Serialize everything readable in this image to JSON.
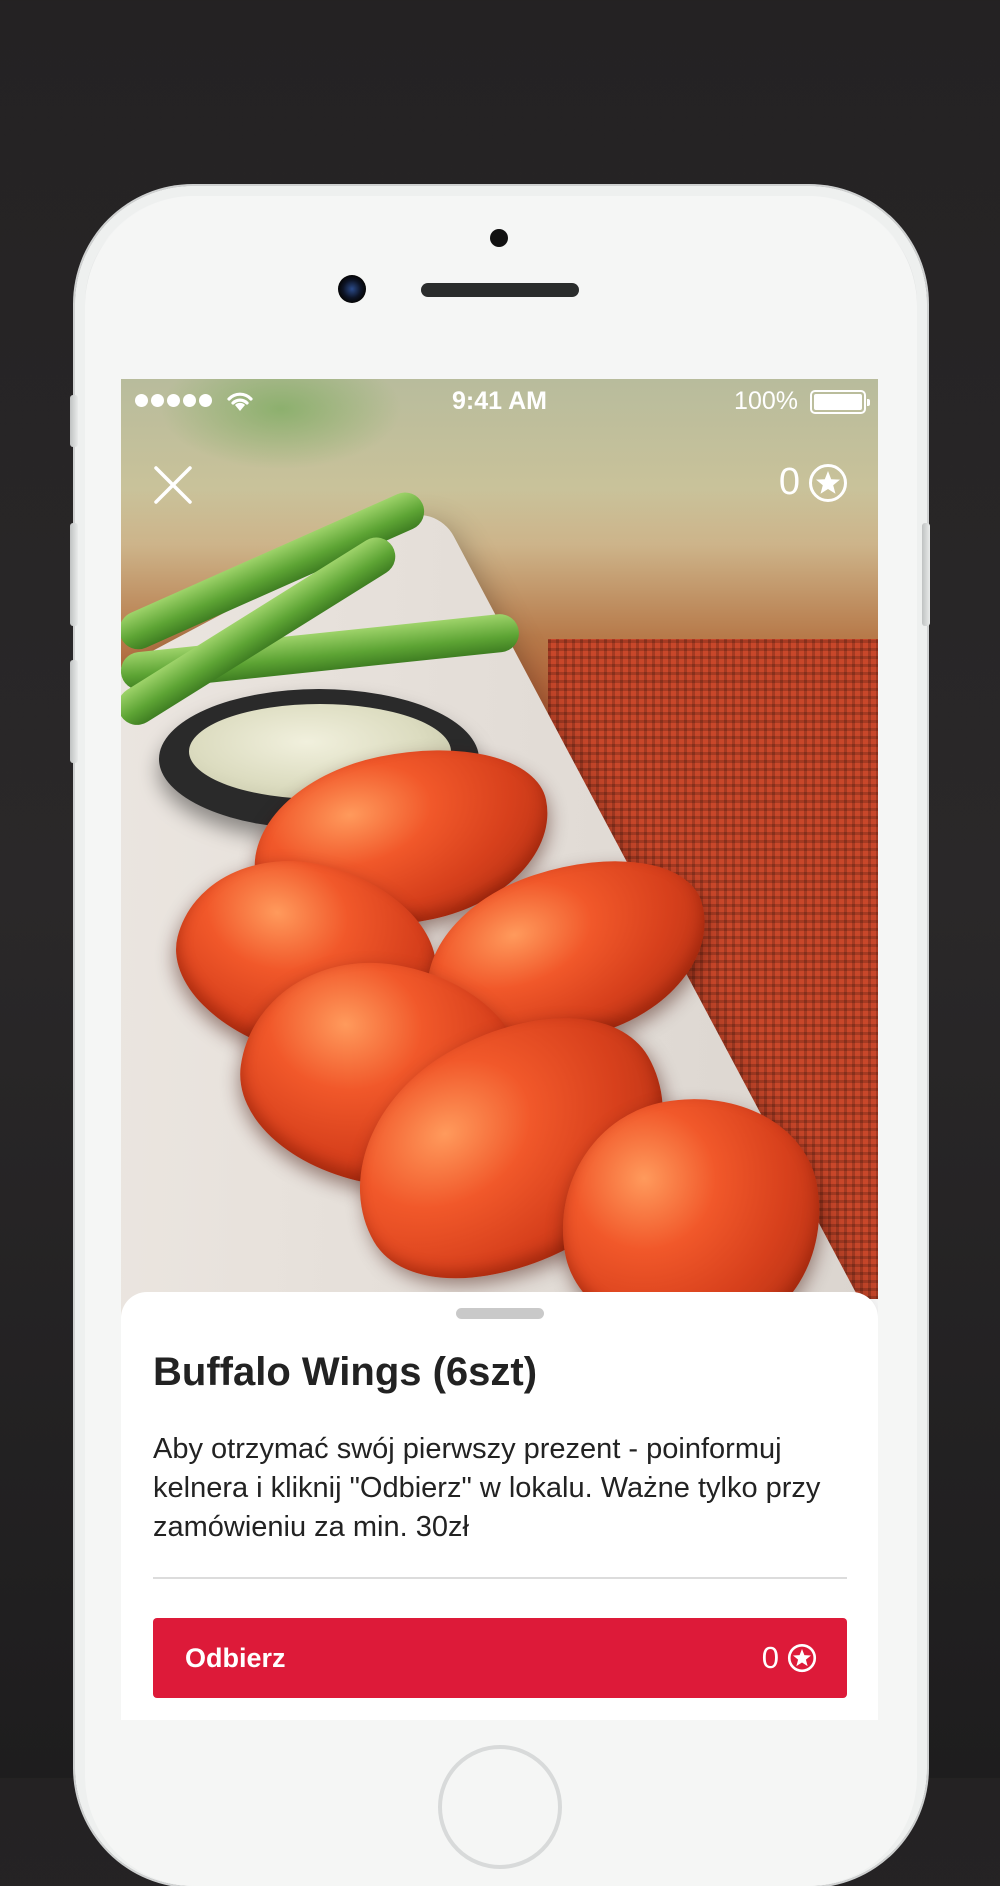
{
  "status_bar": {
    "time": "9:41 AM",
    "battery": "100%"
  },
  "header": {
    "points": "0"
  },
  "item": {
    "title": "Buffalo Wings (6szt)",
    "description": "Aby otrzymać swój pierwszy prezent - poinformuj kelnera i kliknij \"Odbierz\" w lokalu. Ważne tylko przy zamówieniu za min. 30zł"
  },
  "action": {
    "claim_label": "Odbierz",
    "claim_points": "0"
  },
  "colors": {
    "accent": "#dd1a39",
    "background": "#242223",
    "text": "#222222"
  },
  "icons": {
    "close": "close-icon",
    "points": "star-circle-icon",
    "wifi": "wifi-icon",
    "battery": "battery-icon",
    "signal": "signal-dots-icon"
  }
}
